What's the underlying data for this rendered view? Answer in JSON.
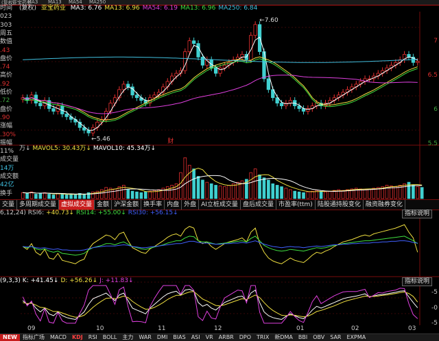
{
  "top_tabs": [
    "(复权)",
    "亚宝药业",
    "MA3",
    "MA13",
    "MA54",
    "MA250"
  ],
  "stock": {
    "adjust_label": "(复权)",
    "name": "亚宝药业",
    "ma": [
      {
        "label": "MA3: 6.76",
        "color": "#ffffff"
      },
      {
        "label": "MA13: 6.96",
        "color": "#f0e040"
      },
      {
        "label": "MA54: 6.19",
        "color": "#e040e0"
      },
      {
        "label": "MA13: 6.96",
        "color": "#40e040"
      },
      {
        "label": "MA250: 6.84",
        "color": "#40c0e0"
      }
    ]
  },
  "left_panel": [
    {
      "text": "时间",
      "color": "#cccccc"
    },
    {
      "text": "023",
      "color": "#cccccc"
    },
    {
      "text": "303",
      "color": "#cccccc"
    },
    {
      "text": "周五",
      "color": "#cccccc"
    },
    {
      "text": "数值",
      "color": "#cccccc"
    },
    {
      "text": ".43",
      "color": "#e03030"
    },
    {
      "text": "盘价",
      "color": "#cccccc"
    },
    {
      "text": ".74",
      "color": "#e03030"
    },
    {
      "text": "高价",
      "color": "#cccccc"
    },
    {
      "text": ".92",
      "color": "#e03030"
    },
    {
      "text": "低价",
      "color": "#cccccc"
    },
    {
      "text": ".72",
      "color": "#3fa53f"
    },
    {
      "text": "盘价",
      "color": "#cccccc"
    },
    {
      "text": ".90",
      "color": "#e03030"
    },
    {
      "text": "涨幅",
      "color": "#cccccc"
    },
    {
      "text": ".30%",
      "color": "#e03030"
    },
    {
      "text": "振幅",
      "color": "#cccccc"
    },
    {
      "text": "11%",
      "color": "#cccccc"
    },
    {
      "text": "成交量",
      "color": "#cccccc"
    },
    {
      "text": "14万",
      "color": "#40c0e0"
    },
    {
      "text": "成交额",
      "color": "#cccccc"
    },
    {
      "text": "42亿",
      "color": "#40c0e0"
    },
    {
      "text": "换手",
      "color": "#cccccc"
    }
  ],
  "price_axis": [
    "7",
    "6.5",
    "6",
    "5.5"
  ],
  "annotations": {
    "high_price": "7.60",
    "low_price": "5.46",
    "finance_mark": "财"
  },
  "volume": {
    "legend": [
      {
        "text": "万↓",
        "color": "#cccccc"
      },
      {
        "text": "MAVOL5: 30.43万↓",
        "color": "#f0e040"
      },
      {
        "text": "MAVOL10: 45.34万↓",
        "color": "#ffffff"
      }
    ]
  },
  "function_tabs": [
    {
      "label": "交量",
      "active": false
    },
    {
      "label": "多周期成交量",
      "active": false
    },
    {
      "label": "虚拟成交量",
      "active": true
    },
    {
      "label": "金额",
      "active": false
    },
    {
      "label": "沪深金额",
      "active": false
    },
    {
      "label": "换手率",
      "active": false
    },
    {
      "label": "内盘",
      "active": false
    },
    {
      "label": "外盘",
      "active": false
    },
    {
      "label": "AI立桩成交量",
      "active": false
    },
    {
      "label": "盘后成交量",
      "active": false
    },
    {
      "label": "市盈率(ttm)",
      "active": false
    },
    {
      "label": "陆股通持股变化",
      "active": false
    },
    {
      "label": "融资融券变化",
      "active": false
    }
  ],
  "rsi": {
    "legend": [
      {
        "text": "6,12,24) RSI6:",
        "color": "#cccccc"
      },
      {
        "text": "+40.73↓",
        "color": "#f0e040"
      },
      {
        "text": "RSI14: +55.00↓",
        "color": "#40e040"
      },
      {
        "text": "RSI30: +56.15↓",
        "color": "#4060ff"
      }
    ],
    "explain": "指标说明"
  },
  "kdj": {
    "legend": [
      {
        "text": "(9,3,3) K: +41.45↓",
        "color": "#ffffff"
      },
      {
        "text": "D: +56.26↓",
        "color": "#f0e040"
      },
      {
        "text": "J: +11.83↓",
        "color": "#e040e0"
      }
    ],
    "explain": "指标说明",
    "axis": [
      "-5",
      "-0",
      "-5"
    ]
  },
  "dates": [
    "09",
    "10",
    "11",
    "12",
    "01",
    "02",
    "03"
  ],
  "bottom_bar": [
    {
      "label": "NEW",
      "type": "new"
    },
    {
      "label": "指标广场",
      "type": ""
    },
    {
      "label": "MACD",
      "type": ""
    },
    {
      "label": "KDJ",
      "type": "active"
    },
    {
      "label": "RSI",
      "type": ""
    },
    {
      "label": "BOLL",
      "type": ""
    },
    {
      "label": "主力",
      "type": ""
    },
    {
      "label": "WAR",
      "type": ""
    },
    {
      "label": "DMI",
      "type": ""
    },
    {
      "label": "BIAS",
      "type": ""
    },
    {
      "label": "ASI",
      "type": ""
    },
    {
      "label": "VR",
      "type": ""
    },
    {
      "label": "ARBR",
      "type": ""
    },
    {
      "label": "DPO",
      "type": ""
    },
    {
      "label": "TRIX",
      "type": ""
    },
    {
      "label": "新DMA",
      "type": ""
    },
    {
      "label": "BBI",
      "type": ""
    },
    {
      "label": "OBV",
      "type": ""
    },
    {
      "label": "SAR",
      "type": ""
    },
    {
      "label": "EXPMA",
      "type": ""
    }
  ],
  "chart_data": [
    {
      "type": "candlestick",
      "title": "",
      "ylim": [
        5.3,
        7.7
      ],
      "candles_close": [
        6.15,
        6.1,
        6.2,
        6.05,
        6.0,
        6.1,
        5.95,
        5.9,
        6.0,
        5.85,
        5.8,
        5.75,
        5.7,
        5.6,
        5.55,
        5.5,
        5.6,
        5.7,
        5.75,
        5.9,
        6.05,
        6.15,
        6.3,
        6.4,
        6.35,
        6.2,
        6.15,
        6.1,
        6.05,
        6.15,
        6.2,
        6.25,
        6.35,
        6.45,
        6.55,
        6.6,
        6.65,
        7.0,
        7.2,
        7.15,
        6.9,
        6.75,
        6.85,
        6.7,
        6.6,
        6.7,
        6.75,
        6.8,
        6.85,
        6.9,
        6.95,
        6.85,
        7.3,
        7.5,
        7.0,
        6.5,
        6.3,
        6.15,
        6.05,
        6.0,
        6.05,
        6.1,
        6.0,
        5.95,
        5.9,
        5.95,
        6.0,
        6.05,
        6.0,
        6.05,
        6.1,
        6.15,
        6.2,
        6.25,
        6.3,
        6.35,
        6.4,
        6.45,
        6.5,
        6.5,
        6.55,
        6.6,
        6.65,
        6.7,
        6.75,
        6.8,
        6.85,
        6.95,
        6.9,
        6.8,
        6.82
      ]
    },
    {
      "type": "bar",
      "title": "Volume",
      "values": [
        8,
        7,
        9,
        6,
        7,
        8,
        6,
        5,
        7,
        6,
        5,
        6,
        5,
        7,
        6,
        8,
        9,
        10,
        12,
        15,
        14,
        13,
        16,
        18,
        12,
        10,
        9,
        8,
        9,
        10,
        11,
        12,
        14,
        16,
        18,
        20,
        35,
        55,
        45,
        40,
        30,
        25,
        22,
        20,
        18,
        17,
        16,
        18,
        20,
        22,
        24,
        26,
        35,
        40,
        32,
        28,
        25,
        20,
        18,
        16,
        14,
        12,
        10,
        9,
        8,
        9,
        10,
        11,
        10,
        9,
        10,
        11,
        12,
        11,
        12,
        13,
        14,
        13,
        12,
        13,
        14,
        15,
        16,
        18,
        17,
        16,
        18,
        20,
        22,
        18,
        16,
        15
      ]
    },
    {
      "type": "line",
      "title": "RSI",
      "series": [
        {
          "name": "RSI6",
          "values": [
            50,
            45,
            55,
            40,
            35,
            45,
            30,
            28,
            38,
            26,
            24,
            22,
            20,
            25,
            28,
            45,
            55,
            60,
            65,
            70,
            68,
            62,
            72,
            75,
            60,
            48,
            44,
            40,
            38,
            46,
            50,
            55,
            60,
            66,
            70,
            72,
            68,
            80,
            85,
            82,
            60,
            55,
            58,
            50,
            45,
            50,
            55,
            58,
            60,
            62,
            65,
            58,
            75,
            82,
            55,
            40,
            30,
            25,
            22,
            20,
            25,
            30,
            26,
            24,
            22,
            28,
            35,
            40,
            38,
            42,
            45,
            50,
            54,
            58,
            60,
            62,
            65,
            68,
            70,
            68,
            72,
            74,
            76,
            78,
            80,
            82,
            85,
            88,
            75,
            65,
            40
          ]
        },
        {
          "name": "RSI14",
          "values": [
            50,
            48,
            50,
            46,
            44,
            46,
            42,
            40,
            42,
            38,
            37,
            36,
            35,
            36,
            38,
            44,
            48,
            50,
            52,
            55,
            55,
            53,
            56,
            58,
            54,
            50,
            48,
            46,
            45,
            47,
            49,
            51,
            53,
            56,
            58,
            60,
            60,
            65,
            68,
            67,
            60,
            58,
            58,
            56,
            54,
            55,
            56,
            57,
            58,
            59,
            60,
            58,
            64,
            68,
            60,
            52,
            48,
            45,
            43,
            42,
            43,
            45,
            44,
            43,
            42,
            44,
            46,
            48,
            47,
            48,
            50,
            52,
            53,
            55,
            56,
            57,
            58,
            59,
            60,
            60,
            61,
            62,
            63,
            64,
            65,
            66,
            67,
            68,
            64,
            60,
            55
          ]
        },
        {
          "name": "RSI30",
          "values": [
            50,
            49,
            50,
            48,
            47,
            48,
            46,
            45,
            46,
            44,
            44,
            43,
            43,
            43,
            44,
            46,
            48,
            49,
            50,
            51,
            51,
            51,
            52,
            53,
            52,
            50,
            49,
            48,
            48,
            49,
            50,
            51,
            52,
            53,
            54,
            55,
            55,
            57,
            59,
            59,
            57,
            56,
            56,
            55,
            54,
            54,
            55,
            55,
            56,
            56,
            57,
            56,
            58,
            60,
            57,
            54,
            52,
            50,
            49,
            48,
            49,
            50,
            49,
            49,
            48,
            49,
            50,
            51,
            50,
            51,
            52,
            53,
            53,
            54,
            54,
            55,
            55,
            56,
            56,
            56,
            57,
            57,
            58,
            58,
            59,
            59,
            60,
            60,
            59,
            57,
            56
          ]
        }
      ]
    },
    {
      "type": "line",
      "title": "KDJ",
      "series": [
        {
          "name": "K",
          "values": [
            60,
            50,
            55,
            40,
            30,
            40,
            25,
            20,
            30,
            20,
            15,
            12,
            10,
            20,
            30,
            50,
            65,
            70,
            75,
            80,
            70,
            60,
            75,
            80,
            60,
            40,
            35,
            30,
            25,
            40,
            50,
            60,
            70,
            78,
            82,
            85,
            75,
            88,
            90,
            85,
            55,
            45,
            50,
            40,
            35,
            45,
            55,
            60,
            65,
            70,
            72,
            60,
            80,
            88,
            55,
            30,
            20,
            15,
            12,
            10,
            18,
            25,
            20,
            15,
            12,
            22,
            35,
            45,
            40,
            45,
            50,
            55,
            60,
            65,
            68,
            70,
            72,
            75,
            78,
            70,
            72,
            75,
            76,
            78,
            80,
            82,
            85,
            86,
            70,
            55,
            41
          ]
        },
        {
          "name": "D",
          "values": [
            55,
            52,
            53,
            48,
            42,
            41,
            36,
            31,
            31,
            27,
            23,
            19,
            16,
            17,
            21,
            31,
            42,
            51,
            59,
            66,
            67,
            65,
            68,
            72,
            68,
            58,
            50,
            43,
            37,
            38,
            42,
            48,
            55,
            63,
            69,
            74,
            74,
            79,
            83,
            84,
            74,
            64,
            59,
            53,
            47,
            46,
            49,
            53,
            57,
            61,
            65,
            63,
            69,
            75,
            68,
            55,
            43,
            34,
            27,
            21,
            20,
            22,
            21,
            19,
            17,
            19,
            24,
            31,
            34,
            38,
            42,
            46,
            51,
            56,
            60,
            63,
            66,
            69,
            72,
            71,
            71,
            72,
            74,
            75,
            77,
            79,
            81,
            83,
            79,
            71,
            56
          ]
        },
        {
          "name": "J",
          "values": [
            70,
            46,
            59,
            24,
            6,
            38,
            3,
            0,
            28,
            6,
            0,
            0,
            0,
            26,
            48,
            88,
            100,
            100,
            100,
            100,
            76,
            50,
            89,
            96,
            44,
            4,
            5,
            4,
            1,
            44,
            66,
            84,
            100,
            100,
            100,
            100,
            77,
            100,
            100,
            87,
            17,
            7,
            32,
            14,
            11,
            43,
            67,
            74,
            81,
            88,
            86,
            54,
            100,
            100,
            29,
            0,
            0,
            0,
            0,
            0,
            14,
            31,
            18,
            7,
            2,
            28,
            57,
            73,
            52,
            59,
            66,
            73,
            78,
            83,
            84,
            84,
            84,
            87,
            90,
            68,
            74,
            81,
            80,
            84,
            86,
            88,
            93,
            92,
            52,
            23,
            12
          ]
        }
      ]
    }
  ]
}
